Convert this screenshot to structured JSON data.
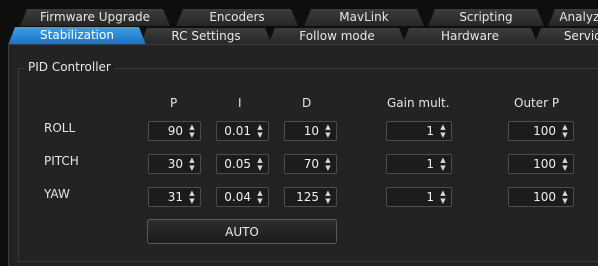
{
  "tabs_row1": [
    {
      "label": "Firmware Upgrade"
    },
    {
      "label": "Encoders"
    },
    {
      "label": "MavLink"
    },
    {
      "label": "Scripting"
    },
    {
      "label": "Analyze"
    }
  ],
  "tabs_row2": [
    {
      "label": "Stabilization",
      "active": true
    },
    {
      "label": "RC Settings"
    },
    {
      "label": "Follow mode"
    },
    {
      "label": "Hardware"
    },
    {
      "label": "Service"
    }
  ],
  "pid": {
    "title": "PID Controller",
    "headers": [
      "P",
      "I",
      "D",
      "Gain mult.",
      "Outer P"
    ],
    "rows": [
      {
        "label": "ROLL",
        "values": [
          "90",
          "0.01",
          "10",
          "1",
          "100"
        ]
      },
      {
        "label": "PITCH",
        "values": [
          "30",
          "0.05",
          "70",
          "1",
          "100"
        ]
      },
      {
        "label": "YAW",
        "values": [
          "31",
          "0.04",
          "125",
          "1",
          "100"
        ]
      }
    ],
    "auto_label": "AUTO"
  },
  "colors": {
    "active_tab": "#1a6fc4",
    "panel": "#232323",
    "background": "#0e0e0e"
  },
  "icons": {
    "spin_up": "chevron-up-icon",
    "spin_down": "chevron-down-icon"
  }
}
